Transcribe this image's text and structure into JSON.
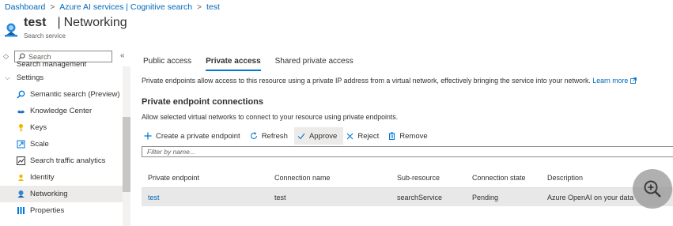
{
  "breadcrumb": [
    "Dashboard",
    "Azure AI services | Cognitive search",
    "test"
  ],
  "header": {
    "resource_name": "test",
    "pipe": "|",
    "page_title": "Networking",
    "resource_type": "Search service"
  },
  "sidebar": {
    "search_placeholder": "Search",
    "collapse_glyph": "«",
    "partial_item": "Search management",
    "group_label": "Settings",
    "items": [
      {
        "label": "Semantic search (Preview)",
        "icon": "semantic-search-icon"
      },
      {
        "label": "Knowledge Center",
        "icon": "knowledge-center-icon"
      },
      {
        "label": "Keys",
        "icon": "key-icon"
      },
      {
        "label": "Scale",
        "icon": "scale-icon"
      },
      {
        "label": "Search traffic analytics",
        "icon": "analytics-icon"
      },
      {
        "label": "Identity",
        "icon": "identity-icon"
      },
      {
        "label": "Networking",
        "icon": "networking-icon",
        "active": true
      },
      {
        "label": "Properties",
        "icon": "properties-icon"
      }
    ]
  },
  "tabs": [
    "Public access",
    "Private access",
    "Shared private access"
  ],
  "description": "Private endpoints allow access to this resource using a private IP address from a virtual network, effectively bringing the service into your network.",
  "learn_more": "Learn more",
  "section_title": "Private endpoint connections",
  "section_desc": "Allow selected virtual networks to connect to your resource using private endpoints.",
  "toolbar": {
    "create": "Create a private endpoint",
    "refresh": "Refresh",
    "approve": "Approve",
    "reject": "Reject",
    "remove": "Remove"
  },
  "filter_placeholder": "Filter by name...",
  "table": {
    "columns": [
      "Private endpoint",
      "Connection name",
      "Sub-resource",
      "Connection state",
      "Description"
    ],
    "rows": [
      [
        "test",
        "test",
        "searchService",
        "Pending",
        "Azure OpenAI on your data"
      ]
    ]
  },
  "colors": {
    "link": "#0067b8",
    "accent": "#0078d4",
    "selected_row": "#e8e8e8"
  }
}
